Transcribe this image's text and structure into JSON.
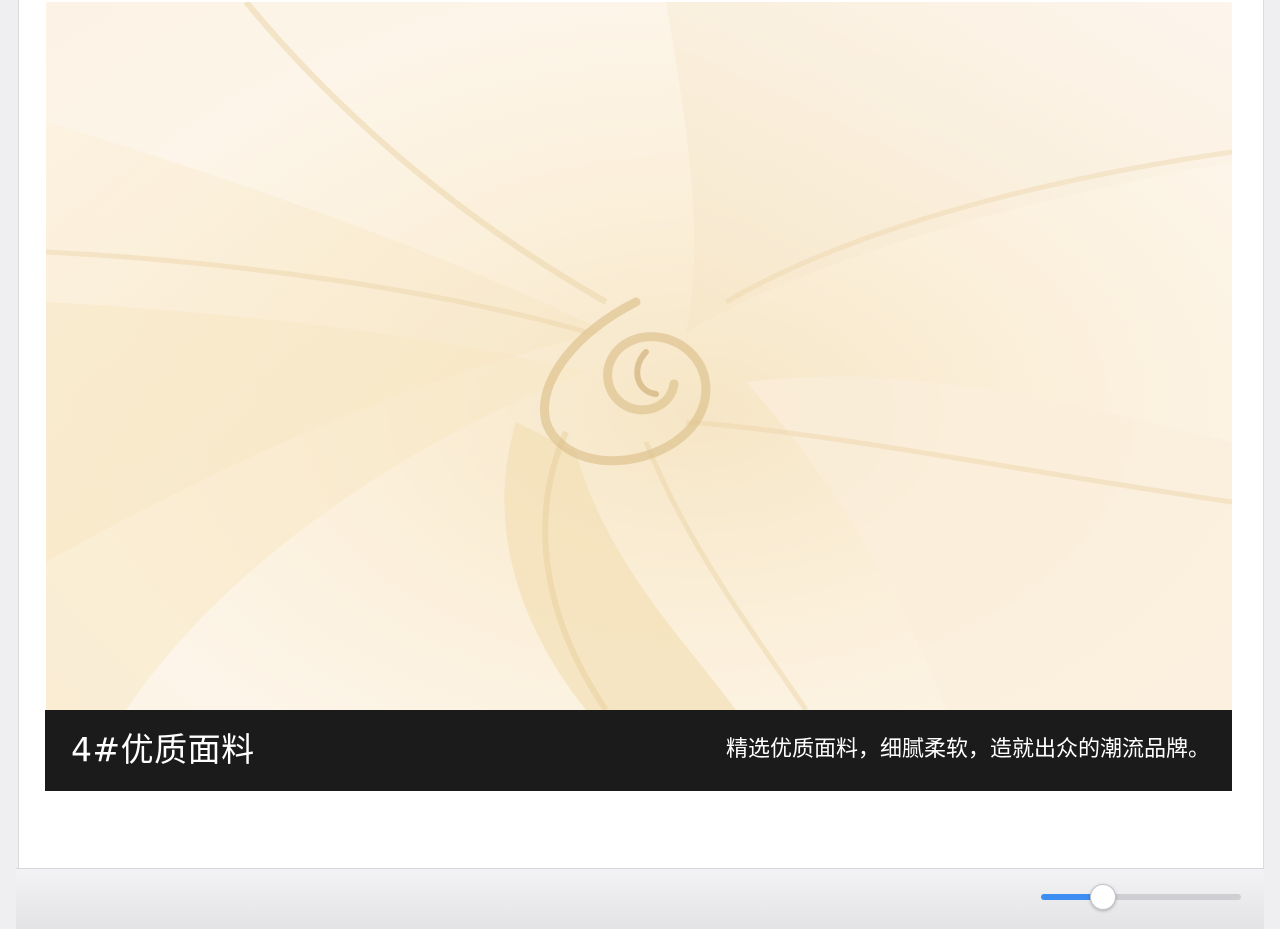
{
  "product_image": {
    "icon": "fabric-swirl-photo",
    "colors": {
      "fabric_light": "#fdf3e7",
      "fabric_cream": "#f7e7c6",
      "fabric_shadow": "#ead3a6"
    }
  },
  "caption": {
    "title": "4#优质面料",
    "description": "精选优质面料，细腻柔软，造就出众的潮流品牌。",
    "background": "#1b1b1b",
    "text_color": "#ffffff"
  },
  "zoom_slider": {
    "value": 0.31,
    "accent": "#3d8ef2"
  }
}
